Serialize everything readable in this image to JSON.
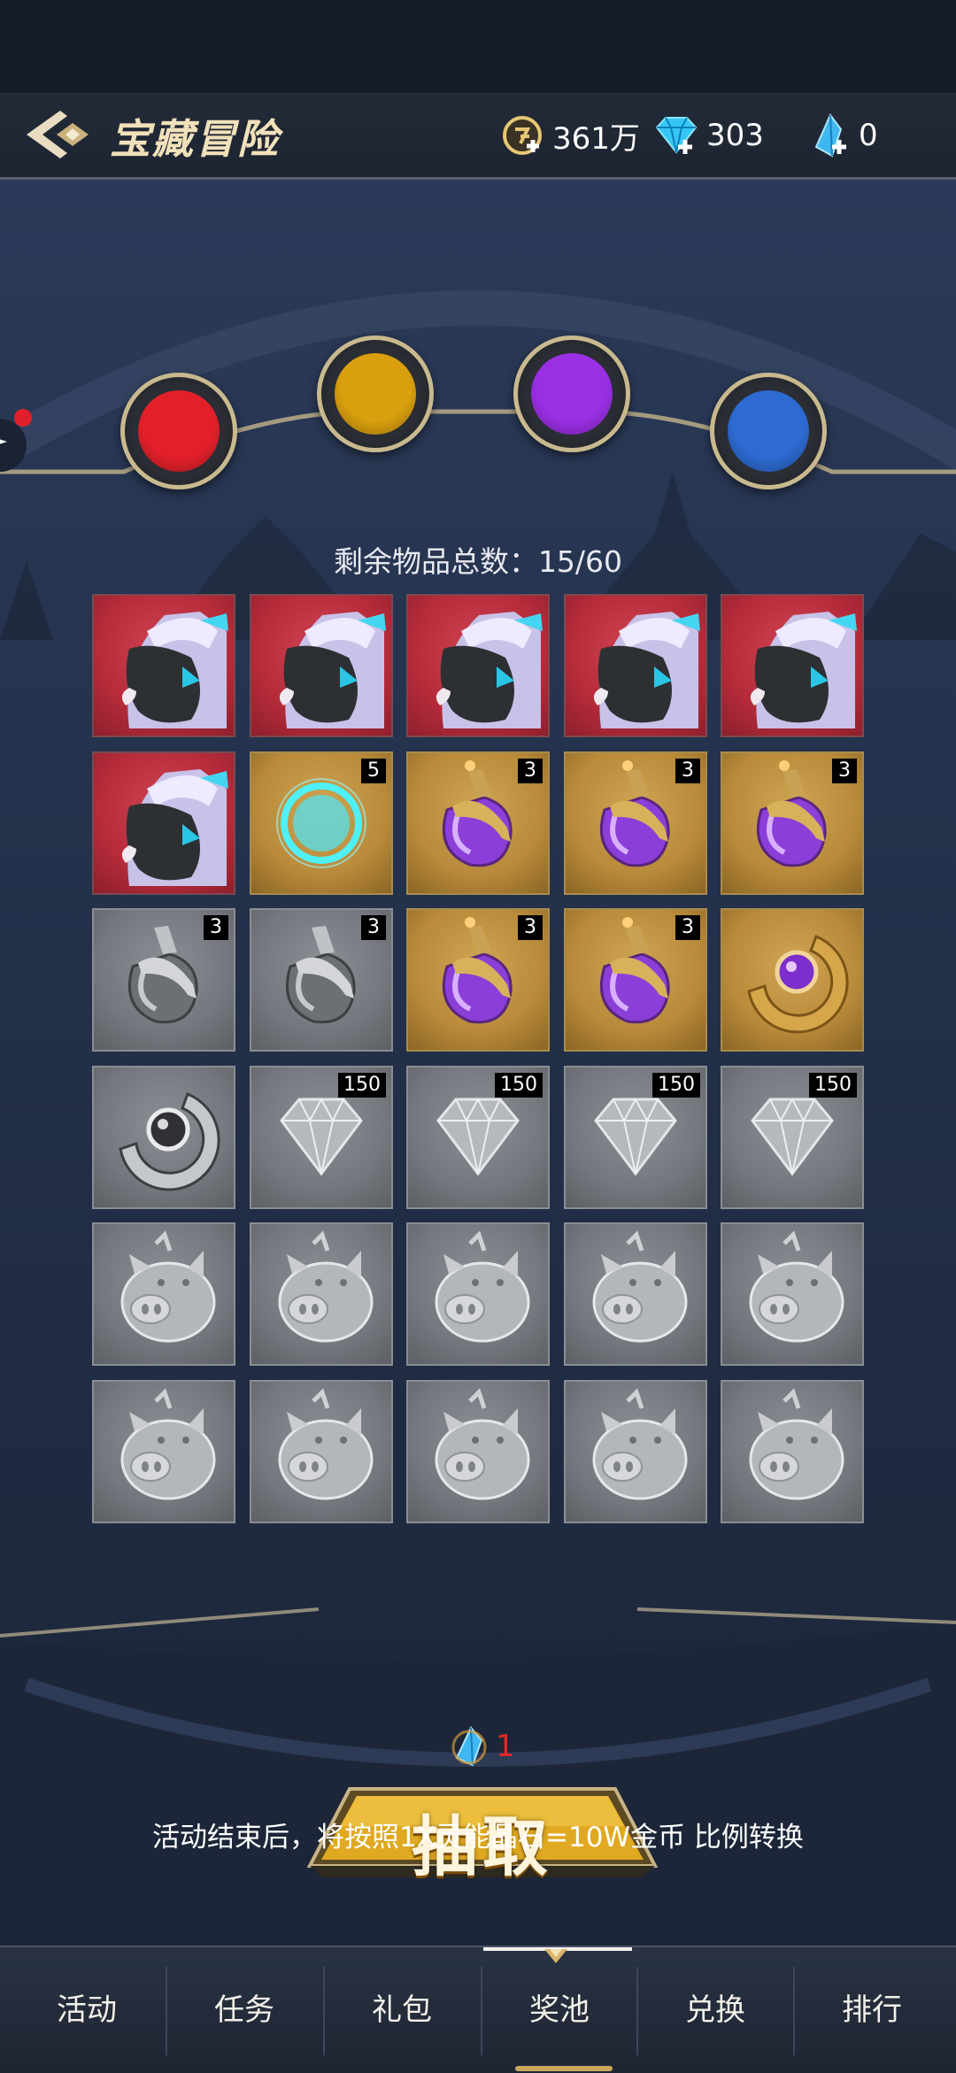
{
  "header": {
    "title": "宝藏冒险",
    "gold_amount": "361万",
    "diamond_amount": "303",
    "crystal_amount": "0"
  },
  "orbs": [
    {
      "color": "#e3202a"
    },
    {
      "color": "#d99f0e"
    },
    {
      "color": "#9a2fe4"
    },
    {
      "color": "#2d6ad1"
    }
  ],
  "remaining_label": "剩余物品总数：15/60",
  "grid": {
    "rows": [
      [
        {
          "item": "dragon-pet",
          "bg": "red",
          "badge": ""
        },
        {
          "item": "dragon-pet",
          "bg": "red",
          "badge": ""
        },
        {
          "item": "dragon-pet",
          "bg": "red",
          "badge": ""
        },
        {
          "item": "dragon-pet",
          "bg": "red",
          "badge": ""
        },
        {
          "item": "dragon-pet",
          "bg": "red",
          "badge": ""
        }
      ],
      [
        {
          "item": "dragon-pet",
          "bg": "red",
          "badge": ""
        },
        {
          "item": "cyan-ring",
          "bg": "gold",
          "badge": "5"
        },
        {
          "item": "purple-potion",
          "bg": "gold",
          "badge": "3"
        },
        {
          "item": "purple-potion",
          "bg": "gold",
          "badge": "3"
        },
        {
          "item": "purple-potion",
          "bg": "gold",
          "badge": "3"
        }
      ],
      [
        {
          "item": "gray-potion",
          "bg": "gray",
          "badge": "3"
        },
        {
          "item": "gray-potion",
          "bg": "gray",
          "badge": "3"
        },
        {
          "item": "purple-potion",
          "bg": "gold",
          "badge": "3"
        },
        {
          "item": "purple-potion",
          "bg": "gold",
          "badge": "3"
        },
        {
          "item": "purple-orb-ring",
          "bg": "gold",
          "badge": ""
        }
      ],
      [
        {
          "item": "gray-orb-ring",
          "bg": "gray",
          "badge": ""
        },
        {
          "item": "diamond",
          "bg": "gray",
          "badge": "150"
        },
        {
          "item": "diamond",
          "bg": "gray",
          "badge": "150"
        },
        {
          "item": "diamond",
          "bg": "gray",
          "badge": "150"
        },
        {
          "item": "diamond",
          "bg": "gray",
          "badge": "150"
        }
      ],
      [
        {
          "item": "pig",
          "bg": "gray",
          "badge": ""
        },
        {
          "item": "pig",
          "bg": "gray",
          "badge": ""
        },
        {
          "item": "pig",
          "bg": "gray",
          "badge": ""
        },
        {
          "item": "pig",
          "bg": "gray",
          "badge": ""
        },
        {
          "item": "pig",
          "bg": "gray",
          "badge": ""
        }
      ],
      [
        {
          "item": "pig",
          "bg": "gray",
          "badge": ""
        },
        {
          "item": "pig",
          "bg": "gray",
          "badge": ""
        },
        {
          "item": "pig",
          "bg": "gray",
          "badge": ""
        },
        {
          "item": "pig",
          "bg": "gray",
          "badge": ""
        },
        {
          "item": "pig",
          "bg": "gray",
          "badge": ""
        }
      ]
    ]
  },
  "draw": {
    "cost": "1",
    "label": "抽取"
  },
  "notice": "活动结束后，将按照1X灵能晶石=10W金币 比例转换",
  "nav": {
    "items": [
      {
        "label": "活动"
      },
      {
        "label": "任务"
      },
      {
        "label": "礼包"
      },
      {
        "label": "奖池"
      },
      {
        "label": "兑换"
      },
      {
        "label": "排行"
      }
    ],
    "active_index": 3
  }
}
